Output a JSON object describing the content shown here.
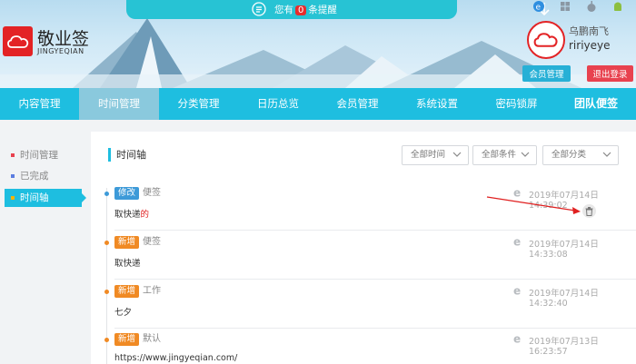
{
  "brand": {
    "name": "敬业签",
    "sub": "JINGYEQIAN"
  },
  "reminder": {
    "prefix": "您有",
    "count": "0",
    "suffix": "条提醒"
  },
  "user": {
    "name": "乌鹏南飞",
    "id": "ririyeye"
  },
  "header_buttons": {
    "member": "会员管理",
    "logout": "退出登录"
  },
  "nav": [
    {
      "label": "内容管理",
      "active": false
    },
    {
      "label": "时间管理",
      "active": true
    },
    {
      "label": "分类管理",
      "active": false
    },
    {
      "label": "日历总览",
      "active": false
    },
    {
      "label": "会员管理",
      "active": false
    },
    {
      "label": "系统设置",
      "active": false
    },
    {
      "label": "密码锁屏",
      "active": false
    },
    {
      "label": "团队便签",
      "active": false
    }
  ],
  "sidebar": [
    {
      "label": "时间管理",
      "color": "#e8424f",
      "active": false
    },
    {
      "label": "已完成",
      "color": "#5b7de0",
      "active": false
    },
    {
      "label": "时间轴",
      "color": "#f6b400",
      "active": true
    }
  ],
  "main": {
    "title": "时间轴",
    "filters": [
      "全部时间",
      "全部条件",
      "全部分类"
    ],
    "entries": [
      {
        "tag": "修改",
        "tag_color": "#3d9ad8",
        "dot_color": "#3d9ad8",
        "category": "便签",
        "content_a": "取快递",
        "content_b": "的",
        "time": "2019年07月14日 14:39:02"
      },
      {
        "tag": "新增",
        "tag_color": "#f08a24",
        "dot_color": "#f08a24",
        "category": "便签",
        "content_a": "取快递",
        "content_b": "",
        "time": "2019年07月14日 14:33:08"
      },
      {
        "tag": "新增",
        "tag_color": "#f08a24",
        "dot_color": "#f08a24",
        "category": "工作",
        "content_a": "七夕",
        "content_b": "",
        "time": "2019年07月14日 14:32:40"
      },
      {
        "tag": "新增",
        "tag_color": "#f08a24",
        "dot_color": "#f08a24",
        "category": "默认",
        "content_a": "https://www.jingyeqian.com/",
        "content_b": "",
        "time": "2019年07月13日 16:23:57"
      }
    ]
  },
  "colors": {
    "nav": "#1ebee0",
    "brand_red": "#e32325",
    "accent_cyan": "#27c3d4"
  },
  "icons": {
    "bell": "bell-icon",
    "down": "arrow-down-icon",
    "trash": "trash-icon",
    "ie": "ie-icon"
  }
}
